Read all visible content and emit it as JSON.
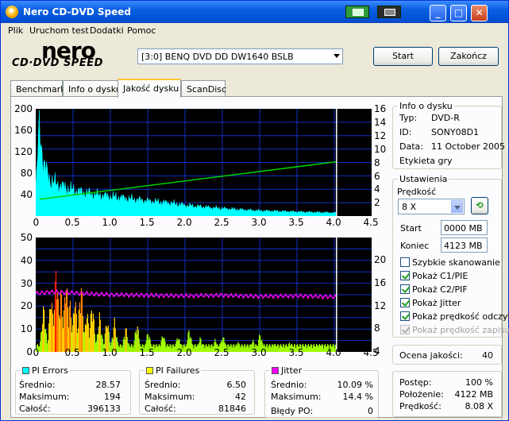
{
  "window": {
    "title": "Nero CD-DVD Speed"
  },
  "menu": [
    "Plik",
    "Uruchom test",
    "Dodatki",
    "Pomoc"
  ],
  "logo": {
    "top": "nero",
    "bottom": "CD·DVD SPEED"
  },
  "drive": {
    "selected": "[3:0]   BENQ DVD DD DW1640 BSLB"
  },
  "buttons": {
    "start": "Start",
    "exit": "Zakończ"
  },
  "tabs": [
    "Benchmark",
    "Info o dysku",
    "Jakość dysku",
    "ScanDisc"
  ],
  "active_tab": "Jakość dysku",
  "chart_data": [
    {
      "type": "area",
      "name": "PI Errors / read speed",
      "x_ticks": [
        "0",
        "0.5",
        "1.0",
        "1.5",
        "2.0",
        "2.5",
        "3.0",
        "3.5",
        "4.0",
        "4.5"
      ],
      "y_left_ticks": [
        "200",
        "160",
        "120",
        "80",
        "40"
      ],
      "y_right_ticks": [
        "16",
        "14",
        "12",
        "10",
        "8",
        "6",
        "4",
        "2"
      ],
      "xlim": [
        0,
        4.5
      ],
      "ylim_left": [
        0,
        200
      ],
      "ylim_right": [
        0,
        16
      ],
      "marker_x": 4.03,
      "pie_envelope": {
        "x": [
          0,
          0.05,
          0.1,
          0.15,
          0.2,
          0.3,
          0.4,
          0.5,
          0.6,
          0.8,
          1.0,
          1.2,
          1.5,
          1.8,
          2.0,
          2.5,
          3.0,
          3.5,
          4.03
        ],
        "y": [
          45,
          170,
          100,
          80,
          65,
          58,
          52,
          48,
          45,
          40,
          36,
          33,
          28,
          24,
          20,
          14,
          10,
          8,
          6
        ]
      },
      "speed_line": {
        "x": [
          0.05,
          4.03
        ],
        "y": [
          2.5,
          8.1
        ]
      },
      "colors": {
        "pie": "#00ffff",
        "speed": "#00d000",
        "grid": "#1030c0",
        "marker": "#ffffff"
      }
    },
    {
      "type": "bar",
      "name": "PI Failures / jitter",
      "x_ticks": [
        "0",
        "0.5",
        "1.0",
        "1.5",
        "2.0",
        "2.5",
        "3.0",
        "3.5",
        "4.0",
        "4.5"
      ],
      "y_left_ticks": [
        "50",
        "40",
        "30",
        "20",
        "10",
        "0"
      ],
      "y_right_ticks": [
        "20",
        "16",
        "12",
        "8",
        "4"
      ],
      "xlim": [
        0,
        4.5
      ],
      "ylim_left": [
        0,
        50
      ],
      "ylim_right": [
        0,
        20
      ],
      "marker_x": 4.03,
      "pif_peaks": {
        "x": [
          0.1,
          0.2,
          0.27,
          0.33,
          0.4,
          0.45,
          0.52,
          0.6,
          0.68,
          0.75,
          0.85,
          0.95,
          1.05,
          1.2,
          1.35,
          1.5,
          1.7,
          1.9,
          2.05,
          2.2,
          2.4,
          2.5,
          2.7,
          2.9,
          3.0,
          3.2,
          3.4,
          3.6,
          3.8,
          4.0
        ],
        "y": [
          22,
          28,
          42,
          30,
          36,
          25,
          27,
          34,
          20,
          24,
          18,
          16,
          15,
          12,
          14,
          10,
          9,
          8,
          11,
          7,
          6,
          8,
          5,
          6,
          9,
          4,
          5,
          3,
          4,
          3
        ]
      },
      "jitter": {
        "x": [
          0,
          0.2,
          0.5,
          1.0,
          1.5,
          2.0,
          2.5,
          3.0,
          3.5,
          4.03
        ],
        "y": [
          10.2,
          10.5,
          10.3,
          10.0,
          9.9,
          9.8,
          9.9,
          9.7,
          9.8,
          9.6
        ]
      },
      "colors": {
        "jitter": "#ff00ff",
        "grid": "#1030c0",
        "marker": "#ffffff"
      }
    }
  ],
  "info": {
    "legend": "Info o dysku",
    "type_label": "Typ:",
    "type": "DVD-R",
    "id_label": "ID:",
    "id": "SONY08D1",
    "date_label": "Data:",
    "date": "11 October 2005",
    "etykieta": "Etykieta gry"
  },
  "settings": {
    "legend": "Ustawienia",
    "speed_label": "Prędkość",
    "speed": "8 X",
    "start_label": "Start",
    "start": "0000 MB",
    "end_label": "Koniec",
    "end": "4123 MB",
    "checks": [
      {
        "label": "Szybkie skanowanie",
        "checked": false,
        "disabled": false
      },
      {
        "label": "Pokaż C1/PIE",
        "checked": true,
        "disabled": false
      },
      {
        "label": "Pokaż C2/PIF",
        "checked": true,
        "disabled": false
      },
      {
        "label": "Pokaż Jitter",
        "checked": true,
        "disabled": false
      },
      {
        "label": "Pokaż prędkość odczytu",
        "checked": true,
        "disabled": false
      },
      {
        "label": "Pokaż prędkość zapisu",
        "checked": true,
        "disabled": true
      }
    ]
  },
  "quality": {
    "label": "Ocena jakości:",
    "value": "40"
  },
  "progress": {
    "postep_label": "Postęp:",
    "postep": "100 %",
    "polozenie_label": "Położenie:",
    "polozenie": "4122 MB",
    "predkosc_label": "Prędkość:",
    "predkosc": "8.08 X"
  },
  "stats": {
    "pie": {
      "title": "PI Errors",
      "color": "#00ffff",
      "avg_label": "Średnio:",
      "avg": "28.57",
      "max_label": "Maksimum:",
      "max": "194",
      "total_label": "Całość:",
      "total": "396133"
    },
    "pif": {
      "title": "PI Failures",
      "color": "#ffff00",
      "avg_label": "Średnio:",
      "avg": "6.50",
      "max_label": "Maksimum:",
      "max": "42",
      "total_label": "Całość:",
      "total": "81846"
    },
    "jitter": {
      "title": "Jitter",
      "color": "#ff00ff",
      "avg_label": "Średnio:",
      "avg": "10.09 %",
      "max_label": "Maksimum:",
      "max": "14.4 %",
      "po_label": "Błędy PO:",
      "po": "0"
    }
  }
}
